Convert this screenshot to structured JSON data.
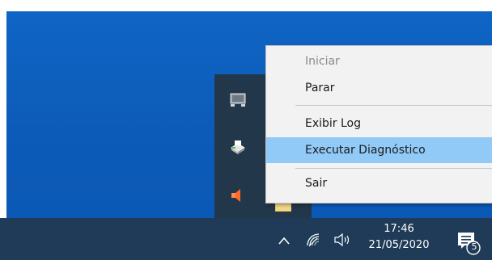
{
  "context_menu": {
    "items": [
      {
        "label": "Iniciar",
        "state": "disabled"
      },
      {
        "label": "Parar",
        "state": "normal"
      },
      {
        "label": "Exibir Log",
        "state": "normal"
      },
      {
        "label": "Executar Diagnóstico",
        "state": "highlighted"
      },
      {
        "label": "Sair",
        "state": "normal"
      }
    ]
  },
  "tray_overflow": {
    "icons": [
      "monitor-icon",
      "printer-app-icon",
      "speaker-muted-icon",
      "folder-icon"
    ]
  },
  "taskbar": {
    "time": "17:46",
    "date": "21/05/2020",
    "notification_count": "5",
    "icons": [
      "chevron-up-icon",
      "wifi-icon",
      "volume-icon",
      "action-center-icon"
    ]
  },
  "colors": {
    "desktop": "#0d5bb8",
    "taskbar": "#1f3b57",
    "menu_background": "#f2f2f2",
    "menu_highlight": "#91c9f7",
    "tray_panel": "#23374a"
  }
}
